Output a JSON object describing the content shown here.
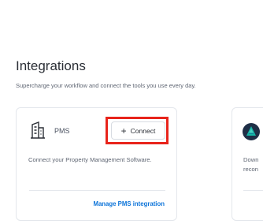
{
  "page": {
    "title": "Integrations",
    "subtitle": "Supercharge your workflow and connect the tools you use every day."
  },
  "cards": [
    {
      "name": "PMS",
      "icon": "building-icon",
      "connect_label": "Connect",
      "description": "Connect your Property Management Software.",
      "manage_label": "Manage PMS integration"
    },
    {
      "icon": "triangle-logo-icon",
      "description_lines": [
        "Down",
        "recon"
      ]
    }
  ],
  "colors": {
    "highlight": "#e8241b",
    "link": "#0d74d9"
  }
}
